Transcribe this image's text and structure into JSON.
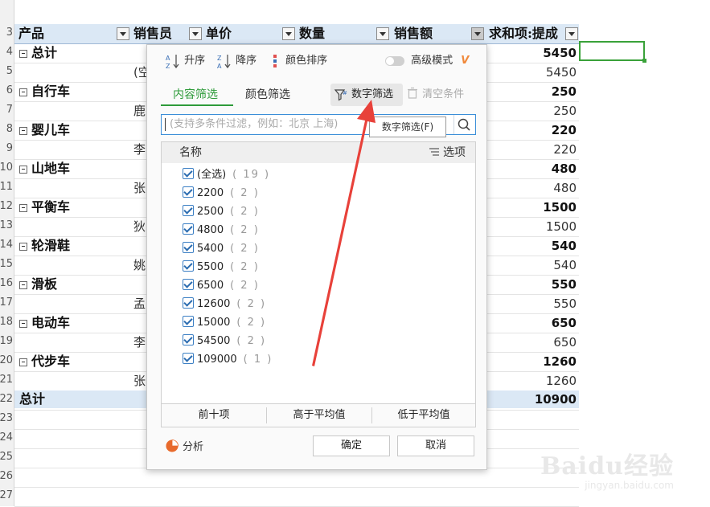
{
  "sheet": {
    "row_numbers": [
      "3",
      "4",
      "5",
      "6",
      "7",
      "8",
      "9",
      "10",
      "11",
      "12",
      "13",
      "14",
      "15",
      "16",
      "17",
      "18",
      "19",
      "20",
      "21",
      "22",
      "23",
      "24",
      "25",
      "26",
      "27"
    ],
    "headers": [
      {
        "label": "产品"
      },
      {
        "label": "销售员"
      },
      {
        "label": "单价"
      },
      {
        "label": "数量"
      },
      {
        "label": "销售额"
      },
      {
        "label": "求和项:提成"
      }
    ],
    "rows": [
      {
        "type": "group",
        "label": "总计",
        "value": "5450"
      },
      {
        "type": "detail",
        "name": "(空",
        "value": "5450"
      },
      {
        "type": "group",
        "label": "自行车",
        "value": "250"
      },
      {
        "type": "detail",
        "name": "鹿",
        "value": "250"
      },
      {
        "type": "group",
        "label": "婴儿车",
        "value": "220"
      },
      {
        "type": "detail",
        "name": "李",
        "value": "220"
      },
      {
        "type": "group",
        "label": "山地车",
        "value": "480"
      },
      {
        "type": "detail",
        "name": "张",
        "value": "480"
      },
      {
        "type": "group",
        "label": "平衡车",
        "value": "1500"
      },
      {
        "type": "detail",
        "name": "狄",
        "value": "1500"
      },
      {
        "type": "group",
        "label": "轮滑鞋",
        "value": "540"
      },
      {
        "type": "detail",
        "name": "姚",
        "value": "540"
      },
      {
        "type": "group",
        "label": "滑板",
        "value": "550"
      },
      {
        "type": "detail",
        "name": "孟",
        "value": "550"
      },
      {
        "type": "group",
        "label": "电动车",
        "value": "650"
      },
      {
        "type": "detail",
        "name": "李",
        "value": "650"
      },
      {
        "type": "group",
        "label": "代步车",
        "value": "1260"
      },
      {
        "type": "detail",
        "name": "张",
        "value": "1260"
      }
    ],
    "grand_total": {
      "label": "总计",
      "value": "10900"
    }
  },
  "panel": {
    "sort_asc": "升序",
    "sort_desc": "降序",
    "color_sort": "颜色排序",
    "advanced_mode": "高级模式",
    "advanced_badge": "V",
    "tabs": {
      "content": "内容筛选",
      "color": "颜色筛选"
    },
    "number_filter": "数字筛选",
    "clear_conditions": "清空条件",
    "search_placeholder": "(支持多条件过滤，例如：北京  上海)",
    "tooltip": "数字筛选(F)",
    "list_header": {
      "name": "名称",
      "options": "选项"
    },
    "items": [
      {
        "label": "(全选)",
        "count": "( 19 )"
      },
      {
        "label": "2200",
        "count": "( 2 )"
      },
      {
        "label": "2500",
        "count": "( 2 )"
      },
      {
        "label": "4800",
        "count": "( 2 )"
      },
      {
        "label": "5400",
        "count": "( 2 )"
      },
      {
        "label": "5500",
        "count": "( 2 )"
      },
      {
        "label": "6500",
        "count": "( 2 )"
      },
      {
        "label": "12600",
        "count": "( 2 )"
      },
      {
        "label": "15000",
        "count": "( 2 )"
      },
      {
        "label": "54500",
        "count": "( 2 )"
      },
      {
        "label": "109000",
        "count": "( 1 )"
      }
    ],
    "quick": {
      "top10": "前十项",
      "above_avg": "高于平均值",
      "below_avg": "低于平均值"
    },
    "analysis": "分析",
    "ok": "确定",
    "cancel": "取消"
  },
  "watermark": {
    "brand": "Baidu经验",
    "url": "jingyan.baidu.com"
  },
  "colors": {
    "accent_green": "#2e9b3a",
    "header_blue": "#dbe8f5",
    "arrow_red": "#e8413a",
    "advanced_orange": "#f0883a"
  }
}
